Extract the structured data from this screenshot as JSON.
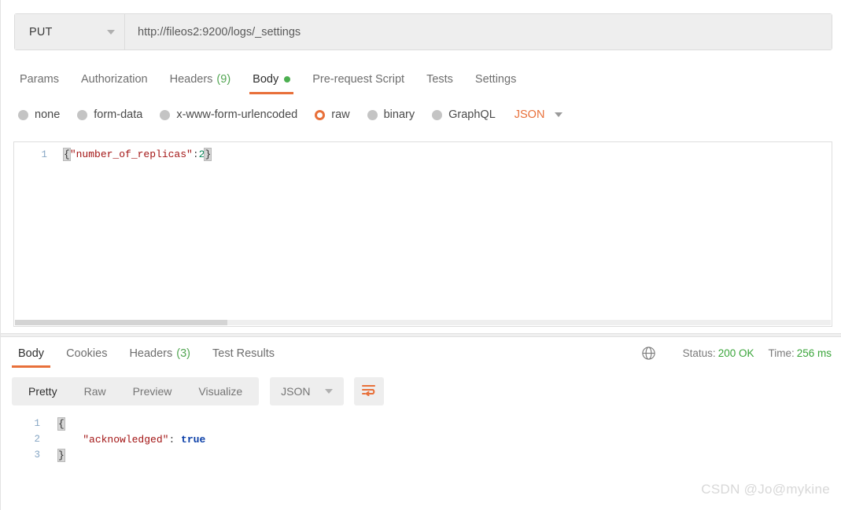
{
  "request": {
    "method": "PUT",
    "url": "http://fileos2:9200/logs/_settings",
    "tabs": [
      {
        "label": "Params",
        "count": "",
        "active": false,
        "dot": false
      },
      {
        "label": "Authorization",
        "count": "",
        "active": false,
        "dot": false
      },
      {
        "label": "Headers",
        "count": "(9)",
        "active": false,
        "dot": false
      },
      {
        "label": "Body",
        "count": "",
        "active": true,
        "dot": true
      },
      {
        "label": "Pre-request Script",
        "count": "",
        "active": false,
        "dot": false
      },
      {
        "label": "Tests",
        "count": "",
        "active": false,
        "dot": false
      },
      {
        "label": "Settings",
        "count": "",
        "active": false,
        "dot": false
      }
    ],
    "body_types": [
      {
        "label": "none",
        "selected": false
      },
      {
        "label": "form-data",
        "selected": false
      },
      {
        "label": "x-www-form-urlencoded",
        "selected": false
      },
      {
        "label": "raw",
        "selected": true
      },
      {
        "label": "binary",
        "selected": false
      },
      {
        "label": "GraphQL",
        "selected": false
      }
    ],
    "raw_format": "JSON",
    "editor": {
      "lines": [
        {
          "number": "1",
          "tokens": [
            {
              "text": "{",
              "type": "brace-hl"
            },
            {
              "text": "\"number_of_replicas\"",
              "type": "tok-key"
            },
            {
              "text": ":",
              "type": "tok-punct"
            },
            {
              "text": "2",
              "type": "tok-num"
            },
            {
              "text": "}",
              "type": "brace-hl"
            }
          ]
        }
      ]
    }
  },
  "response": {
    "tabs": [
      {
        "label": "Body",
        "count": "",
        "active": true
      },
      {
        "label": "Cookies",
        "count": "",
        "active": false
      },
      {
        "label": "Headers",
        "count": "(3)",
        "active": false
      },
      {
        "label": "Test Results",
        "count": "",
        "active": false
      }
    ],
    "status": {
      "globe_icon": "globe-icon",
      "status_label": "Status:",
      "status_value": "200 OK",
      "time_label": "Time:",
      "time_value": "256 ms"
    },
    "view_modes": [
      {
        "label": "Pretty",
        "active": true
      },
      {
        "label": "Raw",
        "active": false
      },
      {
        "label": "Preview",
        "active": false
      },
      {
        "label": "Visualize",
        "active": false
      }
    ],
    "format": "JSON",
    "wrap_icon": "word-wrap-icon",
    "body": {
      "lines": [
        {
          "number": "1",
          "tokens": [
            {
              "text": "{",
              "type": "brace-hl"
            }
          ]
        },
        {
          "number": "2",
          "tokens": [
            {
              "text": "    ",
              "type": "tok-punct"
            },
            {
              "text": "\"acknowledged\"",
              "type": "tok-key"
            },
            {
              "text": ": ",
              "type": "tok-punct"
            },
            {
              "text": "true",
              "type": "tok-bool"
            }
          ]
        },
        {
          "number": "3",
          "tokens": [
            {
              "text": "}",
              "type": "brace-hl"
            }
          ]
        }
      ]
    }
  },
  "watermark": "CSDN @Jo@mykine",
  "colors": {
    "accent": "#e8703a",
    "success": "#3aa53a",
    "dot_green": "#4caf50"
  }
}
